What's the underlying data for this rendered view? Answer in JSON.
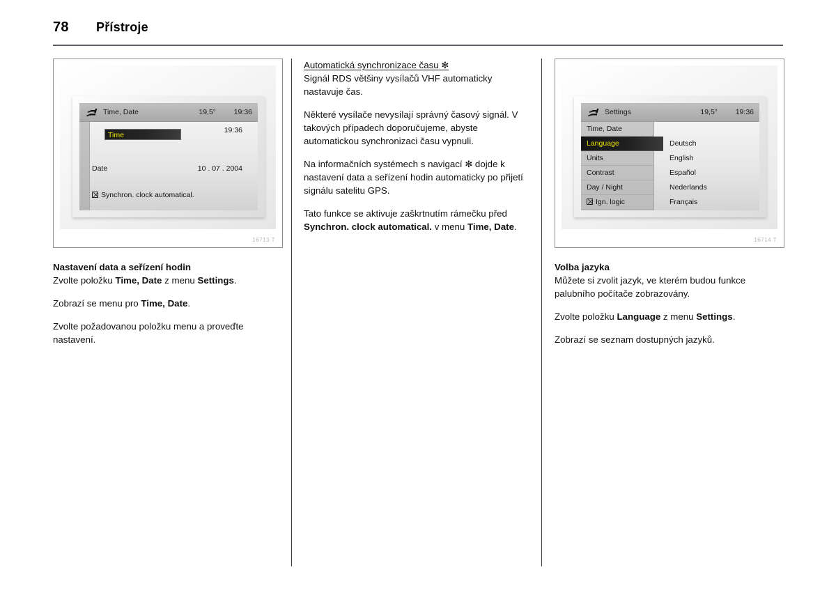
{
  "header": {
    "page_number": "78",
    "title": "Přístroje"
  },
  "figure_left": {
    "code": "16713 T",
    "screen": {
      "icon": "settings-wrench-icon",
      "title": "Time, Date",
      "temperature": "19,5°",
      "clock": "19:36",
      "rows": [
        {
          "label": "Time",
          "value": "19:36",
          "selected": true
        },
        {
          "label": "Date",
          "value": "10 . 07 . 2004",
          "selected": false
        }
      ],
      "checkbox_row": {
        "checked": true,
        "label": "Synchron. clock automatical."
      }
    }
  },
  "figure_right": {
    "code": "16714 T",
    "screen": {
      "icon": "settings-wrench-icon",
      "title": "Settings",
      "temperature": "19,5°",
      "clock": "19:36",
      "menu_items": [
        {
          "label": "Time, Date",
          "selected": false,
          "checkbox": false
        },
        {
          "label": "Language",
          "selected": true,
          "checkbox": false
        },
        {
          "label": "Units",
          "selected": false,
          "checkbox": false
        },
        {
          "label": "Contrast",
          "selected": false,
          "checkbox": false
        },
        {
          "label": "Day / Night",
          "selected": false,
          "checkbox": false
        },
        {
          "label": "Ign. logic",
          "selected": false,
          "checkbox": true
        }
      ],
      "languages": [
        "Deutsch",
        "English",
        "Español",
        "Nederlands",
        "Français"
      ]
    }
  },
  "column_left": {
    "heading": "Nastavení data a seřízení hodin",
    "p1_pre": "Zvolte položku ",
    "p1_b1": "Time, Date",
    "p1_mid": " z menu ",
    "p1_b2": "Settings",
    "p1_end": ".",
    "p2_pre": "Zobrazí se menu pro ",
    "p2_b1": "Time, Date",
    "p2_end": ".",
    "p3": "Zvolte požadovanou položku menu a proveďte nastavení."
  },
  "column_middle": {
    "heading": "Automatická synchronizace času",
    "heading_symbol": "✻",
    "p1": "Signál RDS většiny vysílačů VHF automaticky nastavuje čas.",
    "p2": "Některé vysílače nevysílají správný časový signál. V takových případech doporučujeme, abyste automatickou synchronizaci času vypnuli.",
    "p3_pre": "Na informačních systémech s navigací ",
    "p3_symbol": "✻",
    "p3_end": " dojde k nastavení data a seřízení hodin automaticky po přijetí signálu satelitu GPS.",
    "p4_pre": "Tato funkce se aktivuje zaškrtnutím rámečku před ",
    "p4_b1": "Synchron. clock automatical.",
    "p4_mid": " v menu ",
    "p4_b2": "Time, Date",
    "p4_end": "."
  },
  "column_right": {
    "heading": "Volba jazyka",
    "p1": "Můžete si zvolit jazyk, ve kterém budou funkce palubního počítače zobrazovány.",
    "p2_pre": "Zvolte položku ",
    "p2_b1": "Language",
    "p2_mid": " z menu ",
    "p2_b2": "Settings",
    "p2_end": ".",
    "p3": "Zobrazí se seznam dostupných jazyků."
  }
}
